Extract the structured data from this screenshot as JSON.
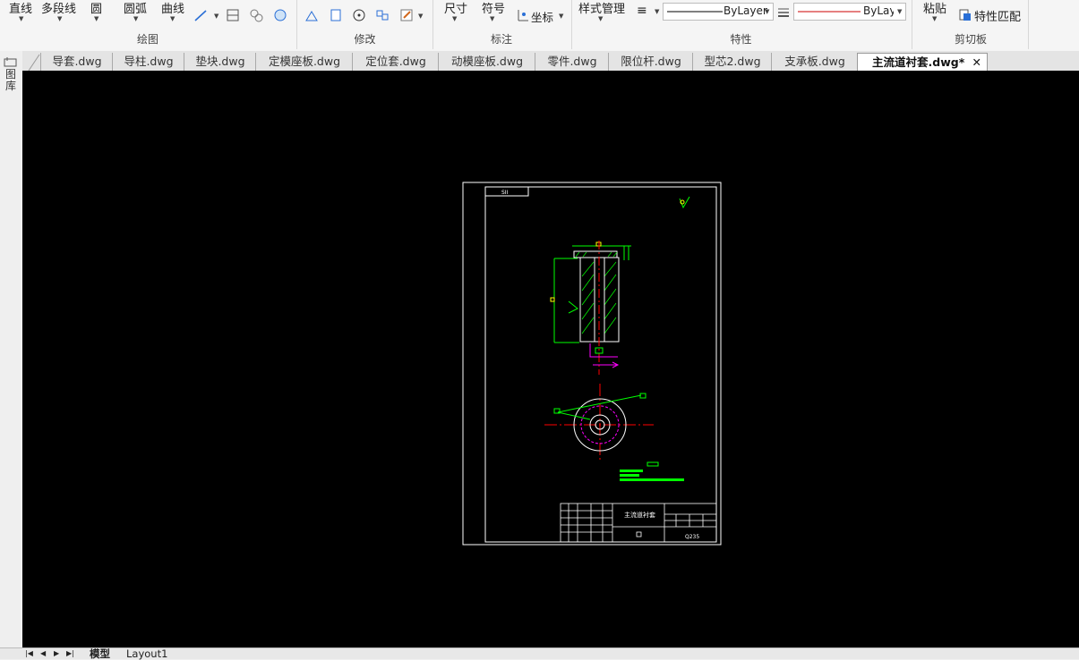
{
  "ribbon": {
    "draw": {
      "line": "直线",
      "polyline": "多段线",
      "circle": "圆",
      "arc": "圆弧",
      "curve": "曲线",
      "group_label": "绘图"
    },
    "modify": {
      "group_label": "修改"
    },
    "annotate": {
      "dimension": "尺寸",
      "symbol": "符号",
      "coordinate": "坐标",
      "group_label": "标注"
    },
    "properties": {
      "style_manager": "样式管理",
      "linetype_value": "ByLayer",
      "lineweight_value": "ByLay",
      "group_label": "特性"
    },
    "clipboard": {
      "paste": "粘贴",
      "match_properties": "特性匹配",
      "group_label": "剪切板"
    }
  },
  "tabs": [
    {
      "label": "导套.dwg"
    },
    {
      "label": "导柱.dwg"
    },
    {
      "label": "垫块.dwg"
    },
    {
      "label": "定模座板.dwg"
    },
    {
      "label": "定位套.dwg"
    },
    {
      "label": "动模座板.dwg"
    },
    {
      "label": "零件.dwg"
    },
    {
      "label": "限位杆.dwg"
    },
    {
      "label": "型芯2.dwg"
    },
    {
      "label": "支承板.dwg"
    },
    {
      "label": "主流道衬套.dwg*"
    }
  ],
  "active_tab_index": 10,
  "left_panel_label": "图库",
  "drawing": {
    "title_block_name": "主流道衬套",
    "title_block_material": "Q235",
    "corner_label": "SII"
  },
  "layout_tabs": {
    "model": "模型",
    "layout1": "Layout1"
  },
  "colors": {
    "canvas": "#000000",
    "dim_green": "#00ff00",
    "center_red": "#ff0000",
    "magenta": "#ff00ff"
  }
}
